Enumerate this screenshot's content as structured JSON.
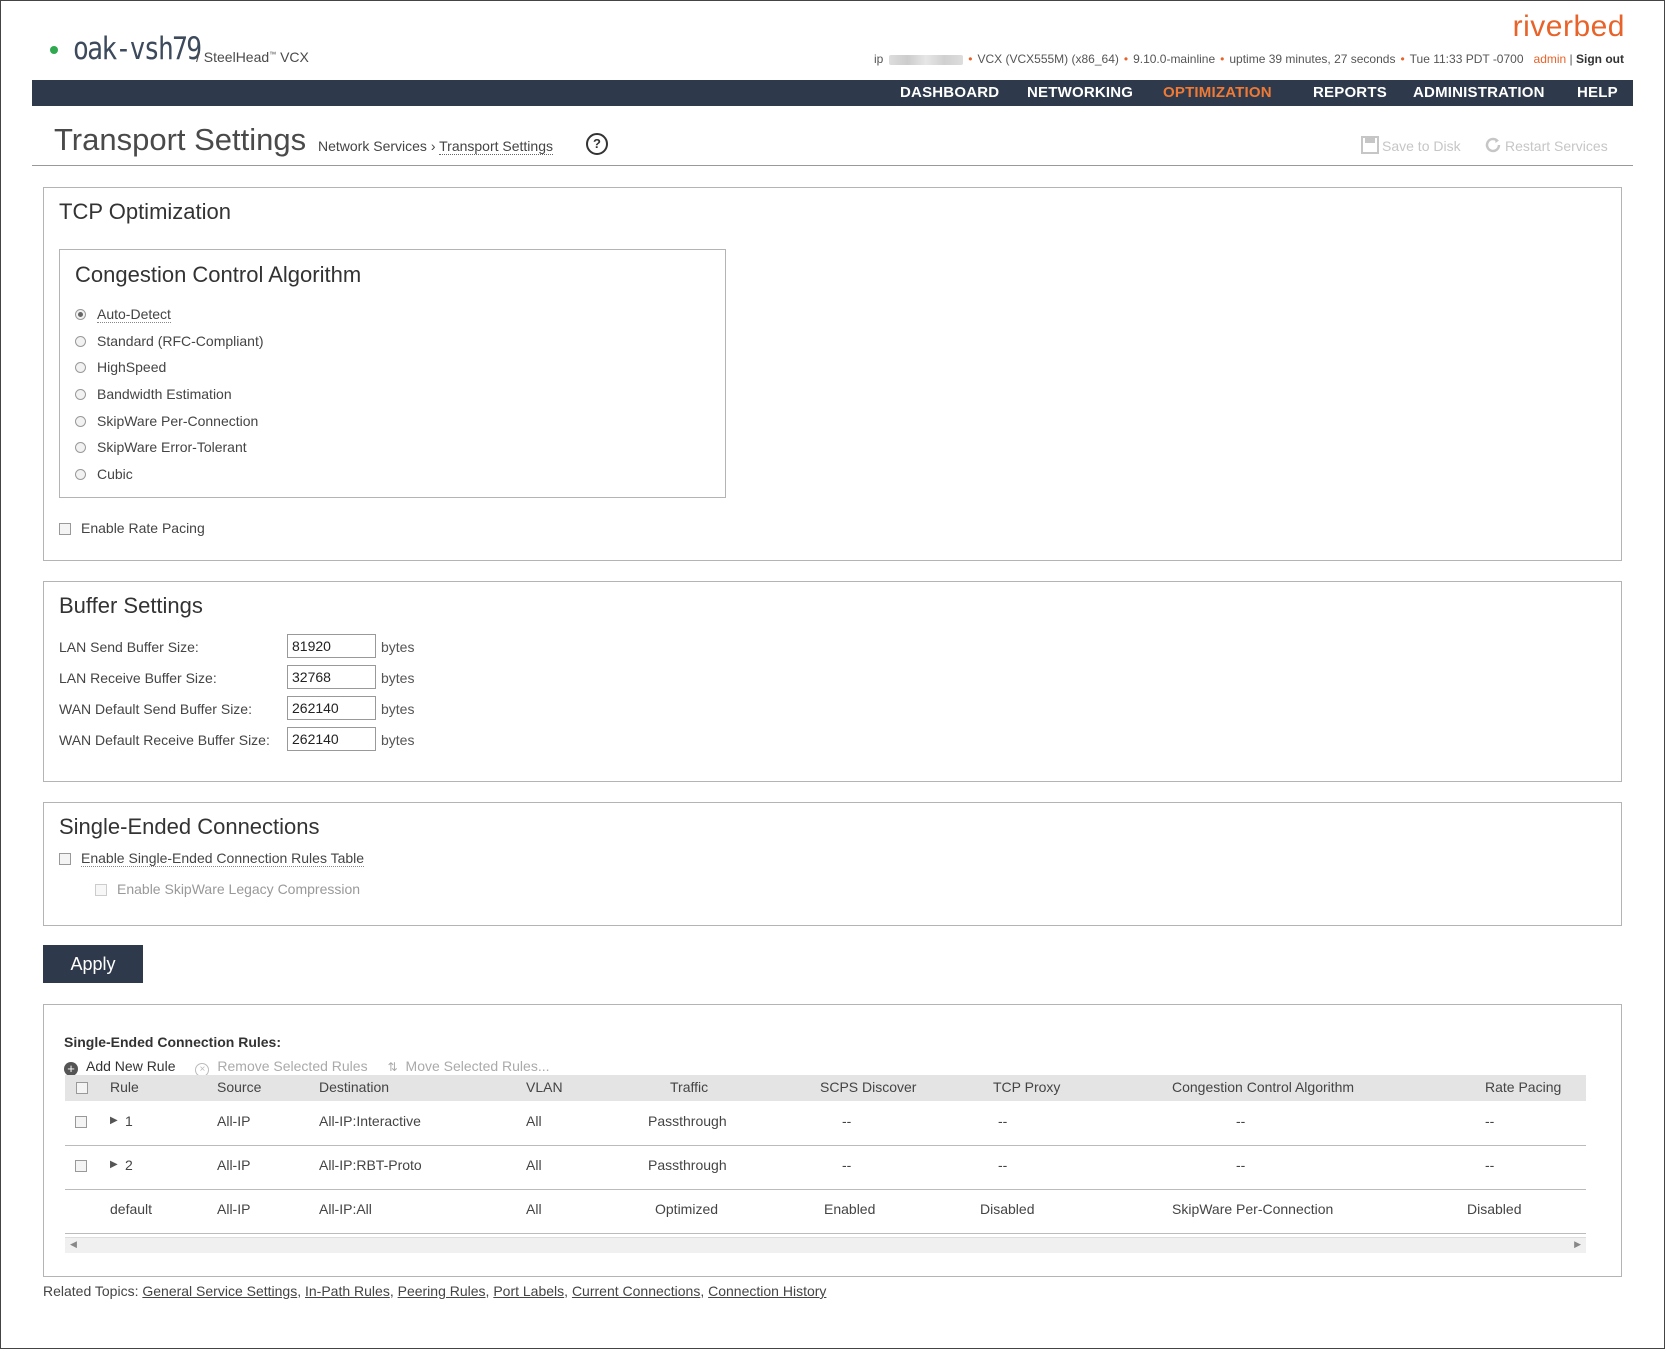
{
  "header": {
    "hostname": "oak-vsh79",
    "product_prefix": "/ SteelHead",
    "product_tm": "™",
    "product_suffix": "VCX",
    "brand": "riverbed",
    "ip_label": "ip",
    "model": "VCX (VCX555M) (x86_64)",
    "version": "9.10.0-mainline",
    "uptime": "uptime 39 minutes, 27 seconds",
    "datetime": "Tue 11:33 PDT -0700",
    "user": "admin",
    "signout": "Sign out",
    "status_color": "#2fa84f"
  },
  "nav": {
    "items": [
      "DASHBOARD",
      "NETWORKING",
      "OPTIMIZATION",
      "REPORTS",
      "ADMINISTRATION",
      "HELP"
    ],
    "active": "OPTIMIZATION"
  },
  "page": {
    "title": "Transport Settings",
    "breadcrumb_parent": "Network Services",
    "breadcrumb_sep": "›",
    "breadcrumb_current": "Transport Settings",
    "help_icon": "?",
    "save_label": "Save to Disk",
    "restart_label": "Restart Services"
  },
  "tcp": {
    "title": "TCP Optimization",
    "algo_title": "Congestion Control Algorithm",
    "options": [
      "Auto-Detect",
      "Standard (RFC-Compliant)",
      "HighSpeed",
      "Bandwidth Estimation",
      "SkipWare Per-Connection",
      "SkipWare Error-Tolerant",
      "Cubic"
    ],
    "selected": "Auto-Detect",
    "rate_pacing_label": "Enable Rate Pacing",
    "rate_pacing_checked": false
  },
  "buffer": {
    "title": "Buffer Settings",
    "fields": [
      {
        "label": "LAN Send Buffer Size:",
        "value": "81920",
        "unit": "bytes"
      },
      {
        "label": "LAN Receive Buffer Size:",
        "value": "32768",
        "unit": "bytes"
      },
      {
        "label": "WAN Default Send Buffer Size:",
        "value": "262140",
        "unit": "bytes"
      },
      {
        "label": "WAN Default Receive Buffer Size:",
        "value": "262140",
        "unit": "bytes"
      }
    ]
  },
  "single_ended": {
    "title": "Single-Ended Connections",
    "enable_rules_label": "Enable Single-Ended Connection Rules Table",
    "enable_rules_checked": false,
    "legacy_label": "Enable SkipWare Legacy Compression",
    "legacy_checked": false
  },
  "apply_label": "Apply",
  "rules": {
    "title": "Single-Ended Connection Rules:",
    "add_label": "Add New Rule",
    "remove_label": "Remove Selected Rules",
    "move_label": "Move Selected Rules...",
    "columns": [
      "Rule",
      "Source",
      "Destination",
      "VLAN",
      "Traffic",
      "SCPS Discover",
      "TCP Proxy",
      "Congestion Control Algorithm",
      "Rate Pacing"
    ],
    "rows": [
      {
        "rule": "1",
        "source": "All-IP",
        "destination": "All-IP:Interactive",
        "vlan": "All",
        "traffic": "Passthrough",
        "scps": "--",
        "proxy": "--",
        "cca": "--",
        "pacing": "--",
        "selectable": true
      },
      {
        "rule": "2",
        "source": "All-IP",
        "destination": "All-IP:RBT-Proto",
        "vlan": "All",
        "traffic": "Passthrough",
        "scps": "--",
        "proxy": "--",
        "cca": "--",
        "pacing": "--",
        "selectable": true
      },
      {
        "rule": "default",
        "source": "All-IP",
        "destination": "All-IP:All",
        "vlan": "All",
        "traffic": "Optimized",
        "scps": "Enabled",
        "proxy": "Disabled",
        "cca": "SkipWare Per-Connection",
        "pacing": "Disabled",
        "selectable": false
      }
    ]
  },
  "related": {
    "label": "Related Topics:",
    "links": [
      "General Service Settings",
      "In-Path Rules",
      "Peering Rules",
      "Port Labels",
      "Current Connections",
      "Connection History"
    ]
  }
}
